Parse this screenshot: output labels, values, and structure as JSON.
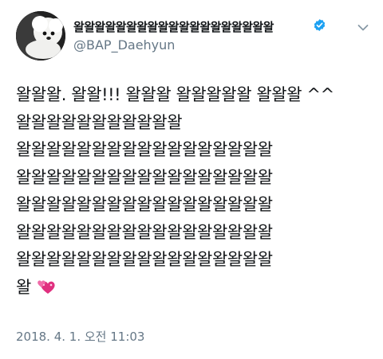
{
  "tweet": {
    "display_name": "왈왈왈왈왈왈왈왈왈왈왈왈왈왈왈왈왈왈왈",
    "handle": "@BAP_Daehyun",
    "verified": true,
    "avatar_icon": "white-dog-avatar",
    "menu_icon": "chevron-down-icon",
    "lines": [
      "왈왈왈. 왈왈!!! 왈왈왈 왈왈왈왈왈 왈왈왈 ^^",
      "왈왈왈왈왈왈왈왈왈왈왈",
      "왈왈왈왈왈왈왈왈왈왈왈왈왈왈왈왈왈",
      "왈왈왈왈왈왈왈왈왈왈왈왈왈왈왈왈왈",
      "왈왈왈왈왈왈왈왈왈왈왈왈왈왈왈왈왈",
      "왈왈왈왈왈왈왈왈왈왈왈왈왈왈왈왈왈",
      "왈왈왈왈왈왈왈왈왈왈왈왈왈왈왈왈왈"
    ],
    "last_line": "왈",
    "last_emoji": "two-hearts-emoji",
    "timestamp": "2018. 4. 1. 오전 11:03",
    "colors": {
      "verified": "#1da1f2",
      "secondary_text": "#657786",
      "heart": "#e0307f"
    }
  }
}
